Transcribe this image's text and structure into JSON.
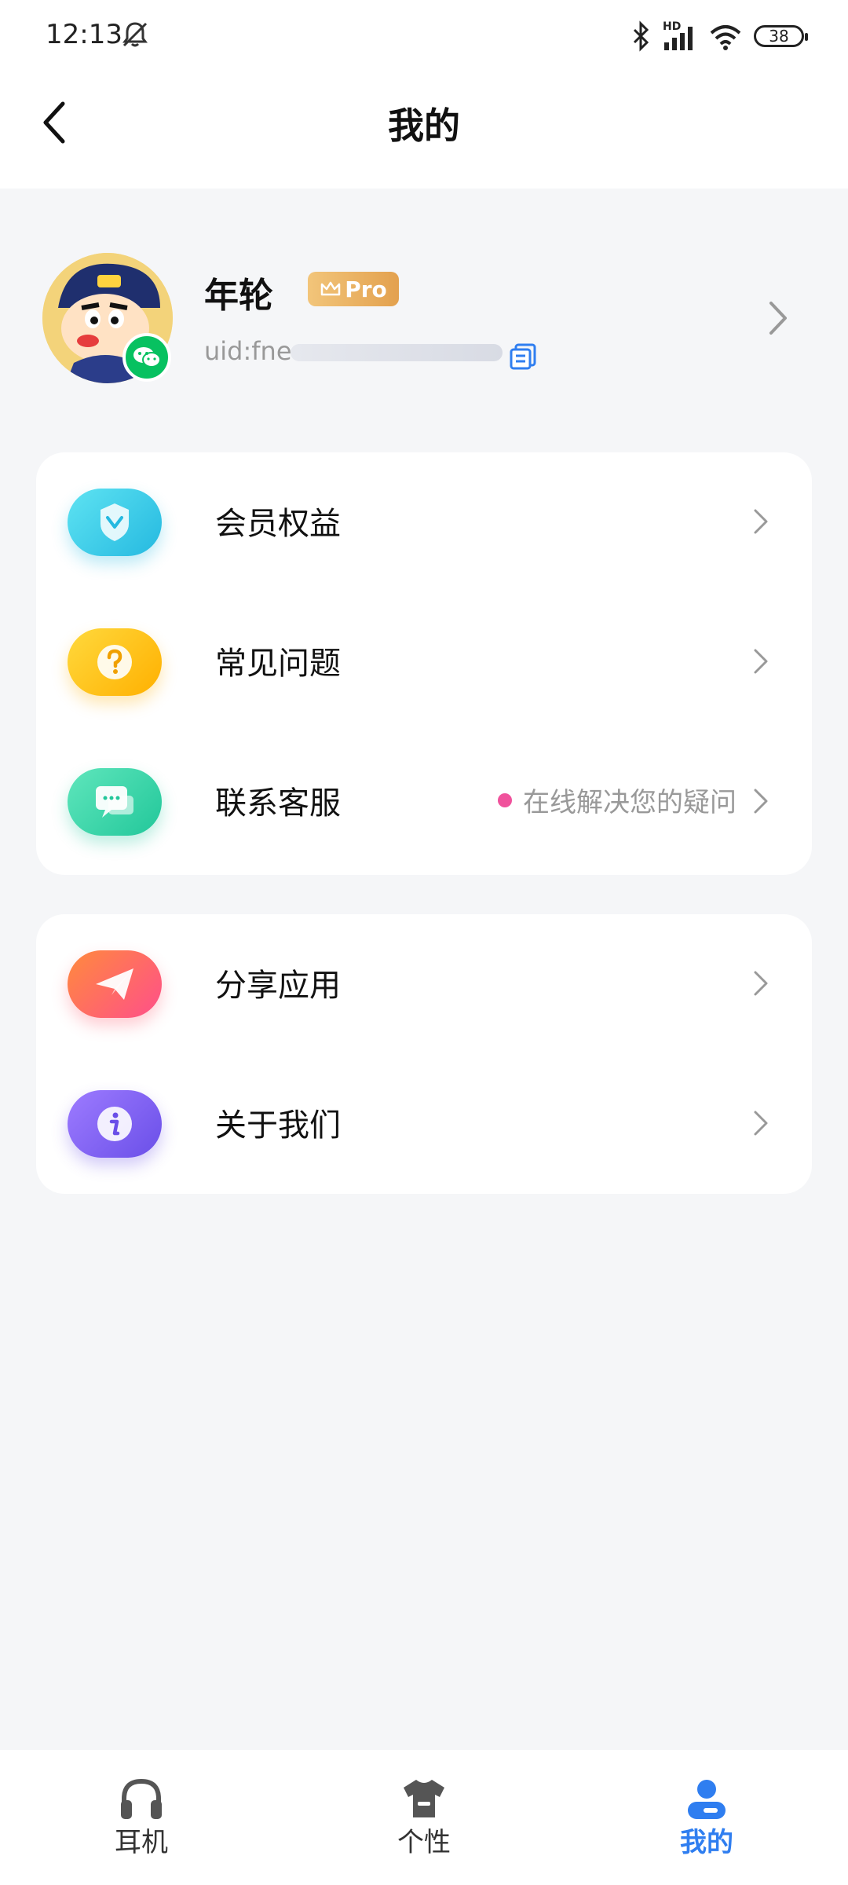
{
  "status_bar": {
    "time": "12:13",
    "hd_label": "HD",
    "battery": "38",
    "icons": [
      "mute-bell-icon",
      "bluetooth-icon",
      "signal-icon",
      "wifi-icon",
      "battery-icon"
    ]
  },
  "nav": {
    "title": "我的",
    "back_icon": "chevron-left-icon"
  },
  "profile": {
    "name": "年轮",
    "badge": "Pro",
    "uid_visible": "uid:fne"
  },
  "menu_group_1": [
    {
      "label": "会员权益",
      "icon": "membership-badge-icon",
      "color": "#3fd0e8"
    },
    {
      "label": "常见问题",
      "icon": "question-icon",
      "color": "#ffc313"
    },
    {
      "label": "联系客服",
      "icon": "chat-icon",
      "color": "#3fd9a6",
      "hint": "在线解决您的疑问"
    }
  ],
  "menu_group_2": [
    {
      "label": "分享应用",
      "icon": "paper-plane-icon",
      "color": "#ff6b5a"
    },
    {
      "label": "关于我们",
      "icon": "info-icon",
      "color": "#8a6df0"
    }
  ],
  "tabs": [
    {
      "label": "耳机",
      "icon": "headphones-icon",
      "active": false
    },
    {
      "label": "个性",
      "icon": "tshirt-icon",
      "active": false
    },
    {
      "label": "我的",
      "icon": "user-icon",
      "active": true
    }
  ],
  "colors": {
    "accent": "#2f7ef0",
    "background": "#f5f6f8",
    "hint_dot": "#f0529c",
    "wechat": "#07c160",
    "pro_badge": "#e3a14e"
  }
}
